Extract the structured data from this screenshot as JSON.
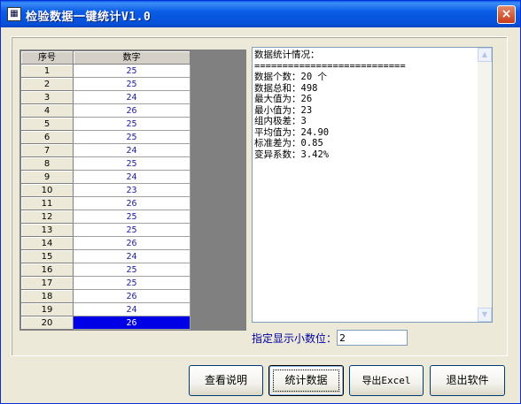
{
  "window": {
    "title": "检验数据一键统计V1.0",
    "icon_name": "app-icon",
    "close_label": "×"
  },
  "grid": {
    "columns": [
      "序号",
      "数字"
    ],
    "rows": [
      {
        "idx": "1",
        "val": "25"
      },
      {
        "idx": "2",
        "val": "25"
      },
      {
        "idx": "3",
        "val": "24"
      },
      {
        "idx": "4",
        "val": "26"
      },
      {
        "idx": "5",
        "val": "25"
      },
      {
        "idx": "6",
        "val": "25"
      },
      {
        "idx": "7",
        "val": "24"
      },
      {
        "idx": "8",
        "val": "25"
      },
      {
        "idx": "9",
        "val": "24"
      },
      {
        "idx": "10",
        "val": "23"
      },
      {
        "idx": "11",
        "val": "26"
      },
      {
        "idx": "12",
        "val": "25"
      },
      {
        "idx": "13",
        "val": "25"
      },
      {
        "idx": "14",
        "val": "26"
      },
      {
        "idx": "15",
        "val": "24"
      },
      {
        "idx": "16",
        "val": "25"
      },
      {
        "idx": "17",
        "val": "25"
      },
      {
        "idx": "18",
        "val": "26"
      },
      {
        "idx": "19",
        "val": "24"
      },
      {
        "idx": "20",
        "val": "26"
      }
    ],
    "selected_row": 20
  },
  "stats": {
    "lines": [
      "数据统计情况：",
      "===========================",
      "数据个数：20 个",
      "数据总和：498",
      "最大值为：26",
      "最小值为：23",
      "组内极差：3",
      "平均值为：24.90",
      "标准差为：0.85",
      "变异系数：3.42%"
    ]
  },
  "precision": {
    "label": "指定显示小数位：",
    "value": "2"
  },
  "buttons": {
    "help": "查看说明",
    "stats": "统计数据",
    "export": "导出Excel",
    "exit": "退出软件"
  },
  "colors": {
    "titlebar": "#0650d8",
    "selection": "#0000e6",
    "value_text": "#1c1c9c",
    "label_text": "#0000a0"
  }
}
